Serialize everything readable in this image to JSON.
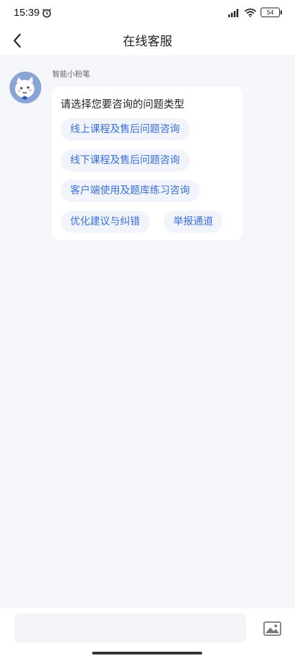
{
  "status_bar": {
    "time": "15:39",
    "battery": "54"
  },
  "nav": {
    "title": "在线客服"
  },
  "chat": {
    "bot_name": "智能小粉笔",
    "message": "请选择您要咨询的问题类型",
    "options": [
      "线上课程及售后问题咨询",
      "线下课程及售后问题咨询",
      "客户端使用及题库练习咨询",
      "优化建议与纠错",
      "举报通道"
    ]
  },
  "input": {
    "placeholder": ""
  },
  "icons": [
    "alarm-icon",
    "signal-icon",
    "wifi-icon",
    "battery-icon",
    "back-icon",
    "image-icon"
  ],
  "colors": {
    "accent": "#3a6fd8",
    "chip_bg": "#f1f4fa",
    "chat_bg": "#f5f6fa"
  }
}
